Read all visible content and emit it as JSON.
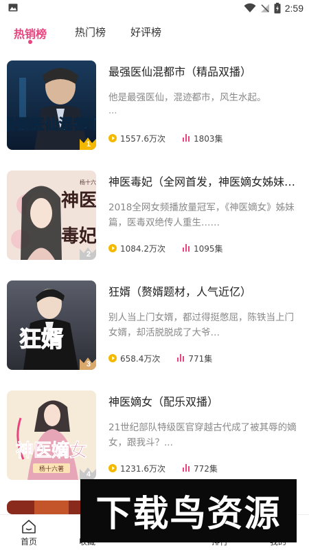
{
  "status_bar": {
    "time": "2:59"
  },
  "tabs": [
    {
      "label": "热销榜",
      "active": true
    },
    {
      "label": "热门榜",
      "active": false
    },
    {
      "label": "好评榜",
      "active": false
    }
  ],
  "colors": {
    "accent": "#e8447f",
    "play": "#f5b800",
    "episodes": "#e8447f"
  },
  "items": [
    {
      "rank": "1",
      "title": "最强医仙混都市（精品双播）",
      "desc": "他是最强医仙，混迹都市，风生水起。",
      "desc_more": "...",
      "plays": "1557.6万次",
      "episodes": "1803集",
      "cover_text": "最强医仙混都市"
    },
    {
      "rank": "2",
      "title": "神医毒妃（全网首发，神医嫡女姊妹…",
      "desc": "2018全网女频播放量冠军，《神医嫡女》姊妹篇，医毒双绝传人重生……",
      "desc_more": "",
      "plays": "1084.2万次",
      "episodes": "1095集",
      "cover_text": "神医毒妃",
      "cover_author": "杨十六"
    },
    {
      "rank": "3",
      "title": "狂婿（赘婿题材，人气近亿）",
      "desc": "别人当上门女婿，都过得挺憋屈，陈铁当上门女婿，却活脱脱成了大爷…",
      "desc_more": "",
      "plays": "658.4万次",
      "episodes": "771集",
      "cover_text": "狂婿"
    },
    {
      "rank": "4",
      "title": "神医嫡女（配乐双播）",
      "desc": "21世纪部队特级医官穿越古代成了被其辱的嫡女，跟我斗？...",
      "desc_more": "",
      "plays": "1231.6万次",
      "episodes": "772集",
      "cover_text": "神医嫡女",
      "cover_author": "杨十六著"
    }
  ],
  "bottom_nav": [
    {
      "label": "首页",
      "icon": "home-icon"
    },
    {
      "label": "收藏",
      "icon": "bookmark-icon"
    },
    {
      "label": "",
      "icon": "center-icon"
    },
    {
      "label": "排行",
      "icon": "rank-icon"
    },
    {
      "label": "我的",
      "icon": "profile-icon"
    }
  ],
  "watermark": {
    "text": "下载鸟资源"
  }
}
